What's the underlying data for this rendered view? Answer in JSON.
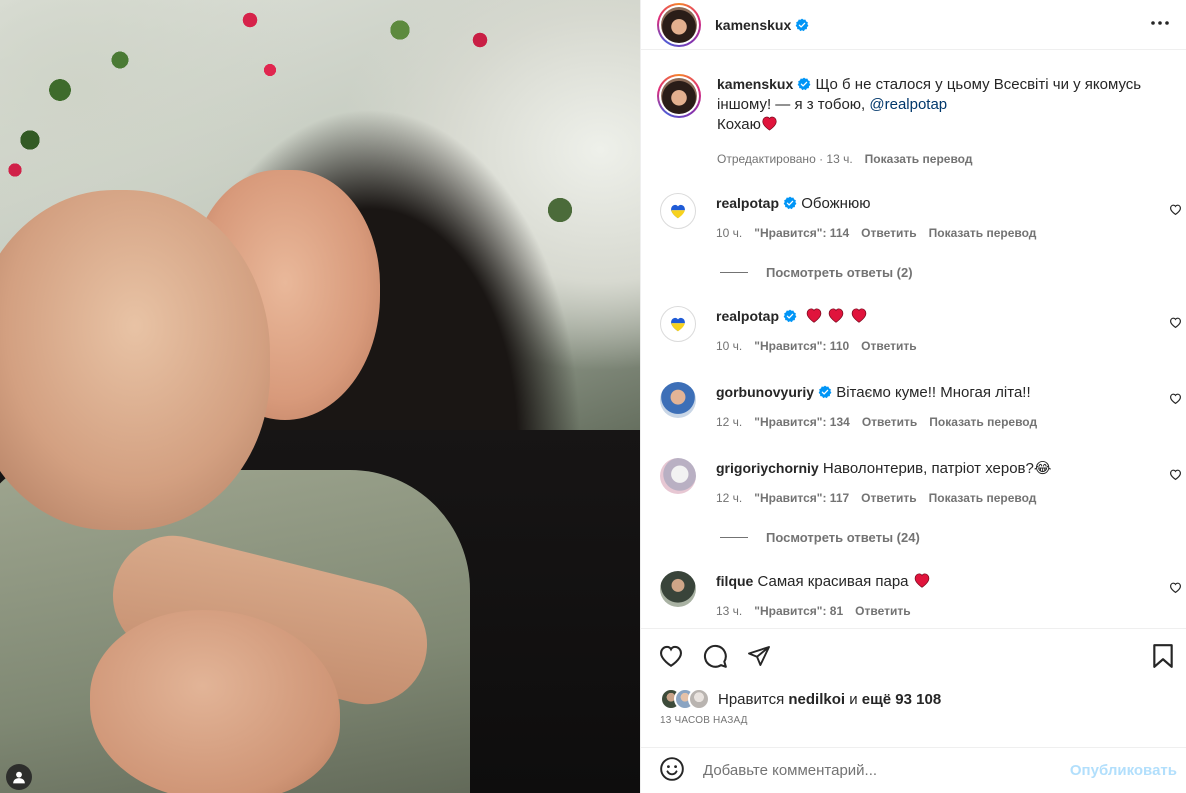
{
  "post": {
    "author": "kamenskux",
    "caption_line1": "Що б не сталося у цьому Всесвіті чи у якомусь іншому! — я з тобою, ",
    "caption_mention": "@realpotap",
    "caption_line2": "Кохаю",
    "edited_label": "Отредактировано · 13 ч.",
    "translate_label": "Показать перевод"
  },
  "comments": [
    {
      "user": "realpotap",
      "text": "Обожнюю",
      "time": "10 ч.",
      "likes": "\"Нравится\": 114",
      "reply": "Ответить",
      "translate": "Показать перевод",
      "view_replies": "Посмотреть ответы (2)"
    },
    {
      "user": "realpotap",
      "text": "",
      "time": "10 ч.",
      "likes": "\"Нравится\": 110",
      "reply": "Ответить"
    },
    {
      "user": "gorbunovyuriy",
      "text": "Вітаємо куме!! Многая літа!!",
      "time": "12 ч.",
      "likes": "\"Нравится\": 134",
      "reply": "Ответить",
      "translate": "Показать перевод"
    },
    {
      "user": "grigoriychorniy",
      "text": "Наволонтерив, патріот херов?😂",
      "time": "12 ч.",
      "likes": "\"Нравится\": 117",
      "reply": "Ответить",
      "translate": "Показать перевод",
      "view_replies": "Посмотреть ответы (24)"
    },
    {
      "user": "filque",
      "text": "Самая красивая пара",
      "time": "13 ч.",
      "likes": "\"Нравится\": 81",
      "reply": "Ответить"
    }
  ],
  "likes_bar": {
    "prefix": "Нравится",
    "user": "nedilkoi",
    "conj": "и",
    "more": "ещё 93 108",
    "time_ago": "13 ЧАСОВ НАЗАД"
  },
  "add_comment": {
    "placeholder": "Добавьте комментарий...",
    "post_label": "Опубликовать"
  },
  "colors": {
    "verified": "#0095f6",
    "heart": "#ed4956",
    "link": "#00376b"
  }
}
